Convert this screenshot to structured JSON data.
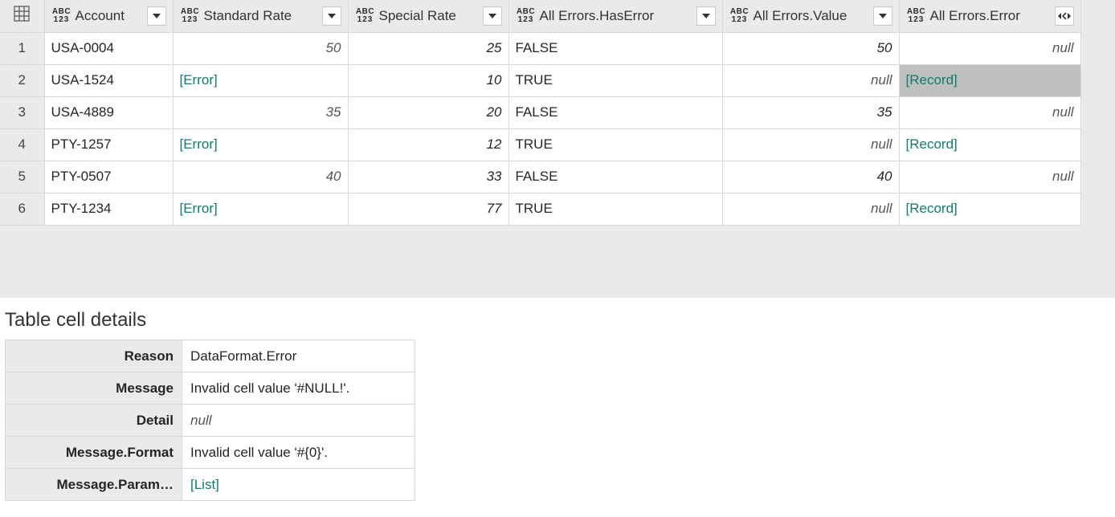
{
  "columns": {
    "account": "Account",
    "std_rate": "Standard Rate",
    "spec_rate": "Special Rate",
    "has_err": "All Errors.HasError",
    "err_val": "All Errors.Value",
    "err_err": "All Errors.Error"
  },
  "text": {
    "error": "[Error]",
    "record": "[Record]",
    "null": "null",
    "list": "[List]"
  },
  "rows": [
    {
      "n": "1",
      "account": "USA-0004",
      "std": "50",
      "std_is_err": false,
      "spec": "25",
      "has": "FALSE",
      "val": "50",
      "val_null": false,
      "err": "null",
      "err_is_rec": false
    },
    {
      "n": "2",
      "account": "USA-1524",
      "std": "",
      "std_is_err": true,
      "spec": "10",
      "has": "TRUE",
      "val": "",
      "val_null": true,
      "err": "",
      "err_is_rec": true,
      "err_selected": true
    },
    {
      "n": "3",
      "account": "USA-4889",
      "std": "35",
      "std_is_err": false,
      "spec": "20",
      "has": "FALSE",
      "val": "35",
      "val_null": false,
      "err": "null",
      "err_is_rec": false
    },
    {
      "n": "4",
      "account": "PTY-1257",
      "std": "",
      "std_is_err": true,
      "spec": "12",
      "has": "TRUE",
      "val": "",
      "val_null": true,
      "err": "",
      "err_is_rec": true
    },
    {
      "n": "5",
      "account": "PTY-0507",
      "std": "40",
      "std_is_err": false,
      "spec": "33",
      "has": "FALSE",
      "val": "40",
      "val_null": false,
      "err": "null",
      "err_is_rec": false
    },
    {
      "n": "6",
      "account": "PTY-1234",
      "std": "",
      "std_is_err": true,
      "spec": "77",
      "has": "TRUE",
      "val": "",
      "val_null": true,
      "err": "",
      "err_is_rec": true
    }
  ],
  "details": {
    "title": "Table cell details",
    "items": [
      {
        "key": "Reason",
        "val": "DataFormat.Error",
        "kind": "text"
      },
      {
        "key": "Message",
        "val": "Invalid cell value '#NULL!'.",
        "kind": "text"
      },
      {
        "key": "Detail",
        "val": "null",
        "kind": "null"
      },
      {
        "key": "Message.Format",
        "val": "Invalid cell value '#{0}'.",
        "kind": "text"
      },
      {
        "key": "Message.Param…",
        "val": "[List]",
        "kind": "link"
      }
    ]
  }
}
